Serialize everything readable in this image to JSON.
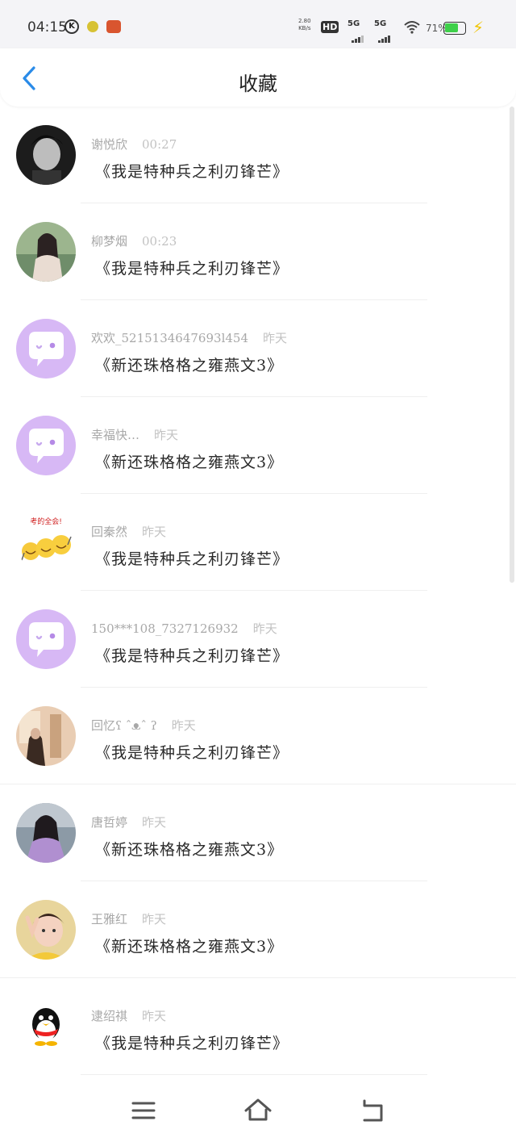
{
  "status_bar": {
    "time": "04:15",
    "k_badge": "K",
    "net_speed_value": "2.80",
    "net_speed_unit": "KB/s",
    "hd_label": "HD",
    "sim1": "5G",
    "sim2": "5G",
    "battery_pct_text": "71%",
    "battery_level": 0.71,
    "battery_color": "#3ed04a"
  },
  "header": {
    "back_icon": "chevron-left-icon",
    "title": "收藏",
    "accent_color": "#2a8be8"
  },
  "favorites": [
    {
      "name": "谢悦欣",
      "time": "00:27",
      "text": "《我是特种兵之利刃锋芒》",
      "avatar": "photo-man"
    },
    {
      "name": "柳梦烟",
      "time": "00:23",
      "text": "《我是特种兵之利刃锋芒》",
      "avatar": "photo-woman"
    },
    {
      "name": "欢欢_5215134647693l454",
      "time": "昨天",
      "text": "《新还珠格格之雍燕文3》",
      "avatar": "default-chat"
    },
    {
      "name": "幸福快…",
      "time": "昨天",
      "text": "《新还珠格格之雍燕文3》",
      "avatar": "default-chat"
    },
    {
      "name": "回秦然",
      "time": "昨天",
      "text": "《我是特种兵之利刃锋芒》",
      "avatar": "emoji-sticker",
      "sticker_text": "考的全会!"
    },
    {
      "name": "150***108_7327126932",
      "time": "昨天",
      "text": "《我是特种兵之利刃锋芒》",
      "avatar": "default-chat"
    },
    {
      "name": "回忆ʕ ˆᴥˆ ʔ",
      "time": "昨天",
      "text": "《我是特种兵之利刃锋芒》",
      "avatar": "photo-room"
    },
    {
      "name": "唐哲婷",
      "time": "昨天",
      "text": "《新还珠格格之雍燕文3》",
      "avatar": "photo-costume"
    },
    {
      "name": "王雅红",
      "time": "昨天",
      "text": "《新还珠格格之雍燕文3》",
      "avatar": "photo-child"
    },
    {
      "name": "逮绍祺",
      "time": "昨天",
      "text": "《我是特种兵之利刃锋芒》",
      "avatar": "qq-penguin"
    }
  ],
  "nav": {
    "menu_icon": "menu-icon",
    "home_icon": "home-icon",
    "back_icon": "back-icon"
  }
}
